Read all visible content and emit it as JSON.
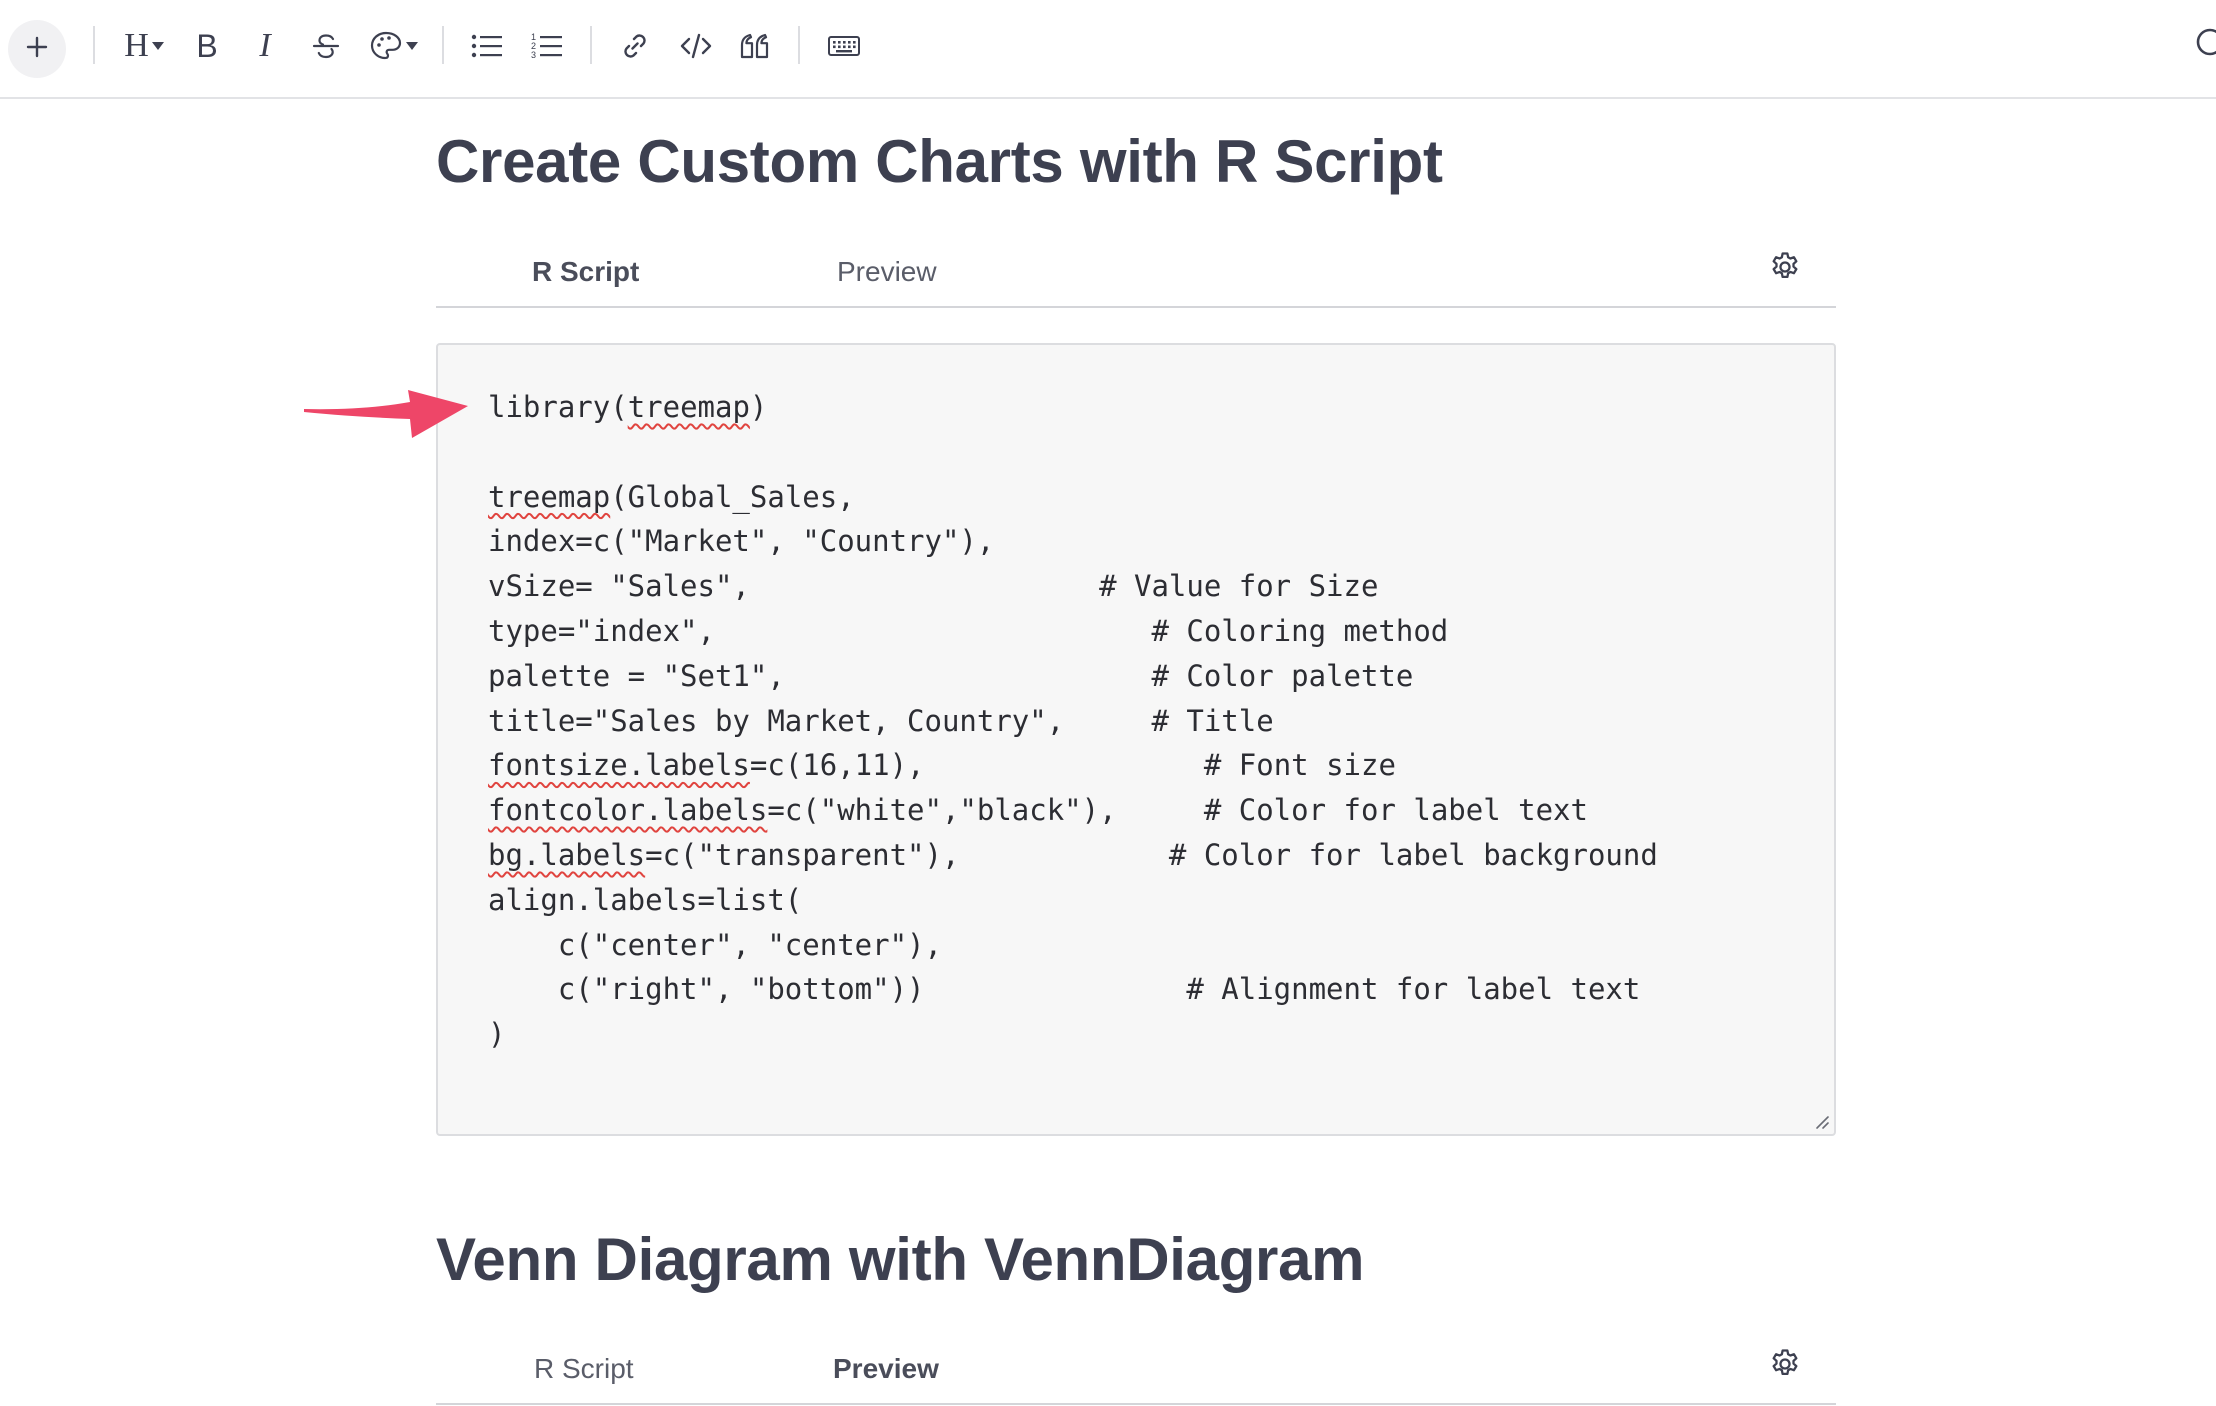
{
  "toolbar": {
    "heading_label": "H",
    "bold_label": "B",
    "italic_label": "I"
  },
  "sections": [
    {
      "title": "Create Custom Charts with R Script",
      "tabs": [
        {
          "label": "R Script",
          "active": true
        },
        {
          "label": "Preview",
          "active": false
        }
      ],
      "code_lines": [
        [
          {
            "t": "library("
          },
          {
            "t": "treemap",
            "spell": true
          },
          {
            "t": ")"
          }
        ],
        [],
        [
          {
            "t": "treemap",
            "spell": true
          },
          {
            "t": "(Global_Sales,"
          }
        ],
        [
          {
            "t": "index=c(\"Market\", \"Country\"),"
          }
        ],
        [
          {
            "t": "vSize= \"Sales\",                    # Value for Size"
          }
        ],
        [
          {
            "t": "type=\"index\",                         # Coloring method"
          }
        ],
        [
          {
            "t": "palette = \"Set1\",                     # Color palette"
          }
        ],
        [
          {
            "t": "title=\"Sales by Market, Country\",     # Title"
          }
        ],
        [
          {
            "t": "fontsize.labels",
            "spell": true
          },
          {
            "t": "=c(16,11),                # Font size"
          }
        ],
        [
          {
            "t": "fontcolor.labels",
            "spell": true
          },
          {
            "t": "=c(\"white\",\"black\"),     # Color for label text"
          }
        ],
        [
          {
            "t": "bg.labels",
            "spell": true
          },
          {
            "t": "=c(\"transparent\"),            # Color for label background"
          }
        ],
        [
          {
            "t": "align.labels=list("
          }
        ],
        [
          {
            "t": "    c(\"center\", \"center\"),"
          }
        ],
        [
          {
            "t": "    c(\"right\", \"bottom\"))               # Alignment for label text"
          }
        ],
        [
          {
            "t": ")"
          }
        ]
      ]
    },
    {
      "title": "Venn Diagram with VennDiagram",
      "tabs": [
        {
          "label": "R Script",
          "active": false
        },
        {
          "label": "Preview",
          "active": true
        }
      ]
    }
  ],
  "colors": {
    "arrow": "#ee4668",
    "text": "#3d4050",
    "editor_bg": "#f7f7f7",
    "spell_underline": "#e0443f"
  }
}
